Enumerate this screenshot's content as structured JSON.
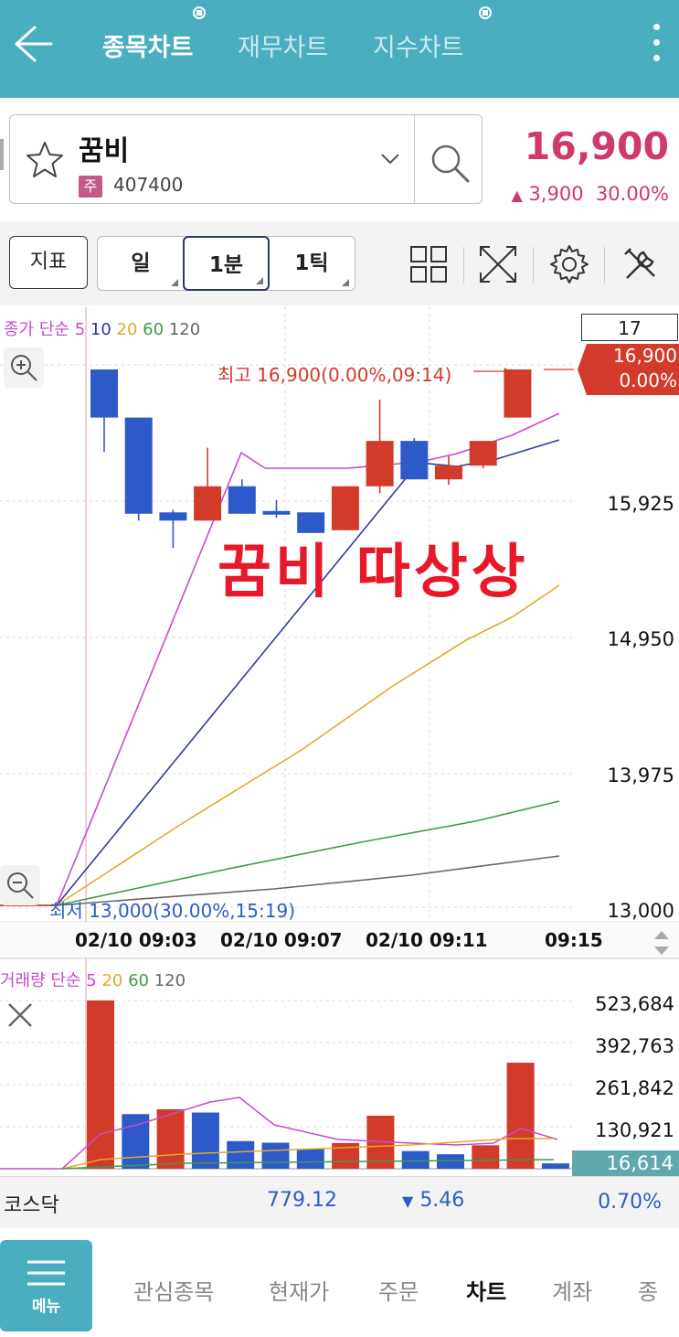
{
  "header": {
    "tabs": [
      {
        "label": "종목차트",
        "active": true
      },
      {
        "label": "재무차트"
      },
      {
        "label": "지수차트"
      }
    ]
  },
  "stock": {
    "name": "꿈비",
    "market_badge": "주",
    "code": "407400",
    "price": "16,900",
    "change": "3,900",
    "change_pct": "30.00%"
  },
  "toolbar": {
    "indicator_label": "지표",
    "periods": [
      "일",
      "1분",
      "1틱"
    ],
    "selected_period": "1분"
  },
  "chart": {
    "legend_price": {
      "prefix": "종가 단순",
      "periods": [
        "5",
        "10",
        "20",
        "60",
        "120"
      ]
    },
    "current_box": "17",
    "current_price": "16,900",
    "current_pct": "0.00%",
    "high_annotation": "최고 16,900(0.00%,09:14)",
    "low_annotation": "최저 13,000(30.00%,15:19)",
    "overlay_text": "꿈비  따상상",
    "y_ticks": [
      "15,925",
      "14,950",
      "13,975",
      "13,000"
    ],
    "x_ticks": [
      "02/10 09:03",
      "02/10 09:07",
      "02/10 09:11",
      "09:15"
    ]
  },
  "chart_data": [
    {
      "type": "candlestick",
      "title": "",
      "ylim": [
        13000,
        16900
      ],
      "y_ticks": [
        15925,
        14950,
        13975,
        13000
      ],
      "x_ticks": [
        "02/10 09:03",
        "02/10 09:07",
        "02/10 09:11",
        "09:15"
      ],
      "candles": [
        {
          "o": 16900,
          "h": 16900,
          "l": 16300,
          "c": 16550,
          "dir": "down"
        },
        {
          "o": 16550,
          "h": 16550,
          "l": 15800,
          "c": 15850,
          "dir": "down"
        },
        {
          "o": 15860,
          "h": 15880,
          "l": 15600,
          "c": 15800,
          "dir": "down"
        },
        {
          "o": 15800,
          "h": 16330,
          "l": 15800,
          "c": 16050,
          "dir": "up"
        },
        {
          "o": 16050,
          "h": 16100,
          "l": 15850,
          "c": 15850,
          "dir": "down"
        },
        {
          "o": 15870,
          "h": 15950,
          "l": 15820,
          "c": 15870,
          "dir": "down"
        },
        {
          "o": 15860,
          "h": 15860,
          "l": 15710,
          "c": 15710,
          "dir": "down"
        },
        {
          "o": 15730,
          "h": 16050,
          "l": 15730,
          "c": 16050,
          "dir": "up"
        },
        {
          "o": 16050,
          "h": 16680,
          "l": 16000,
          "c": 16380,
          "dir": "up"
        },
        {
          "o": 16380,
          "h": 16400,
          "l": 16100,
          "c": 16100,
          "dir": "down"
        },
        {
          "o": 16100,
          "h": 16270,
          "l": 16060,
          "c": 16200,
          "dir": "up"
        },
        {
          "o": 16200,
          "h": 16380,
          "l": 16180,
          "c": 16380,
          "dir": "up"
        },
        {
          "o": 16550,
          "h": 16900,
          "l": 16550,
          "c": 16900,
          "dir": "up"
        }
      ],
      "moving_averages": [
        {
          "name": "5",
          "color": "#c94bc9"
        },
        {
          "name": "10",
          "color": "#2f3c9a"
        },
        {
          "name": "20",
          "color": "#e3a92a"
        },
        {
          "name": "60",
          "color": "#3e9a49"
        },
        {
          "name": "120",
          "color": "#666666"
        }
      ]
    },
    {
      "type": "bar",
      "legend": {
        "prefix": "거래량 단순",
        "periods": [
          "5",
          "20",
          "60",
          "120"
        ]
      },
      "y_ticks": [
        523684,
        392763,
        261842,
        130921
      ],
      "current": "16,614",
      "values": [
        523684,
        170000,
        185000,
        175000,
        86000,
        81000,
        62000,
        80000,
        165000,
        55000,
        45000,
        73000,
        330000,
        16614
      ],
      "directions": [
        "up",
        "down",
        "up",
        "down",
        "down",
        "down",
        "down",
        "up",
        "up",
        "down",
        "down",
        "up",
        "up",
        "down"
      ]
    }
  ],
  "index_bar": {
    "name": "코스닥",
    "value": "779.12",
    "change": "5.46",
    "pct": "0.70%"
  },
  "bottom_nav": {
    "menu": "메뉴",
    "items": [
      {
        "label": "관심종목"
      },
      {
        "label": "현재가"
      },
      {
        "label": "주문"
      },
      {
        "label": "차트",
        "active": true
      },
      {
        "label": "계좌"
      },
      {
        "label": "종"
      }
    ]
  },
  "colors": {
    "header": "#4aaec0",
    "up": "#d23a2a",
    "down": "#2d5ac8",
    "price": "#d03a68",
    "overlay": "#e8182b"
  }
}
